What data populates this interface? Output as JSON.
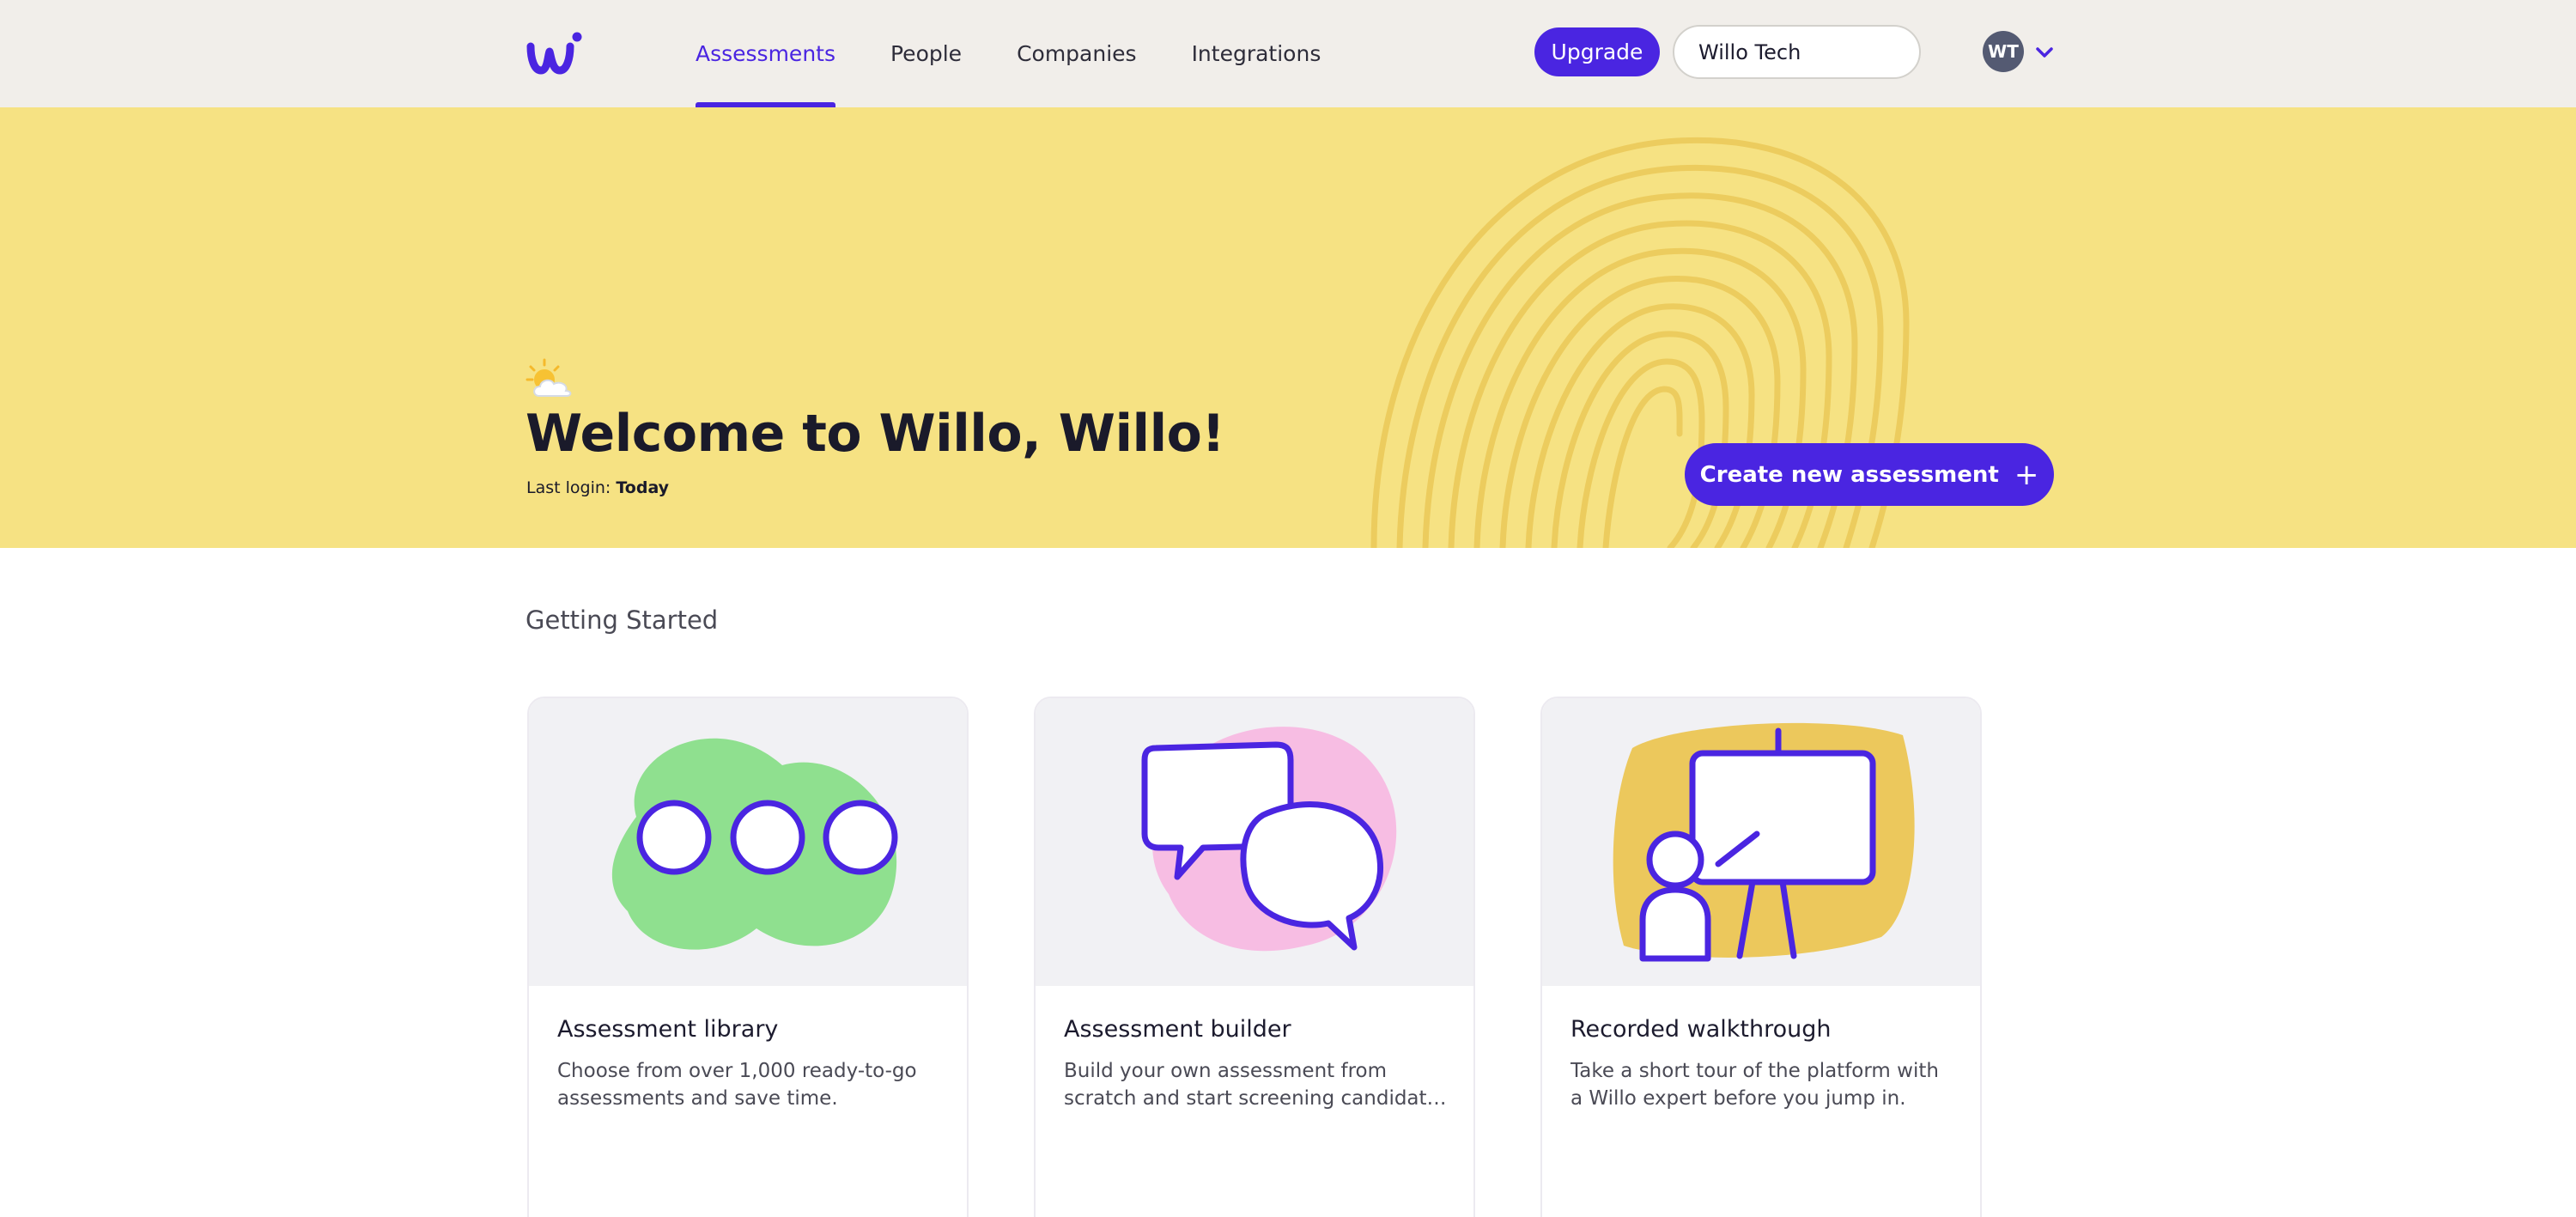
{
  "app": {
    "brand_color": "#4a25e1",
    "hero_color": "#f6e283"
  },
  "nav": {
    "items": [
      {
        "label": "Assessments",
        "active": true
      },
      {
        "label": "People",
        "active": false
      },
      {
        "label": "Companies",
        "active": false
      },
      {
        "label": "Integrations",
        "active": false
      }
    ],
    "upgrade_label": "Upgrade",
    "company_name": "Willo Tech",
    "avatar_initials": "WT",
    "icons": [
      "willo-logo",
      "chevron-down-icon"
    ]
  },
  "hero": {
    "icon": "sun-behind-cloud-icon",
    "title": "Welcome to Willo, Willo!",
    "last_login_label": "Last login:",
    "last_login_value": "Today",
    "create_button_label": "Create new assessment",
    "create_button_icon": "plus-icon"
  },
  "getting_started": {
    "title": "Getting Started",
    "cards": [
      {
        "title": "Assessment library",
        "description": "Choose from over 1,000 ready-to-go assessments and save time.",
        "illustration": "three-bubbles-illustration",
        "accent": "#8fe08f"
      },
      {
        "title": "Assessment builder",
        "description": "Build your own assessment from scratch and start screening candidates today.",
        "illustration": "speech-bubbles-illustration",
        "accent": "#f7bde3"
      },
      {
        "title": "Recorded walkthrough",
        "description": "Take a short tour of the platform with a Willo expert before you jump in.",
        "illustration": "presentation-board-illustration",
        "accent": "#ecc85c"
      }
    ]
  }
}
